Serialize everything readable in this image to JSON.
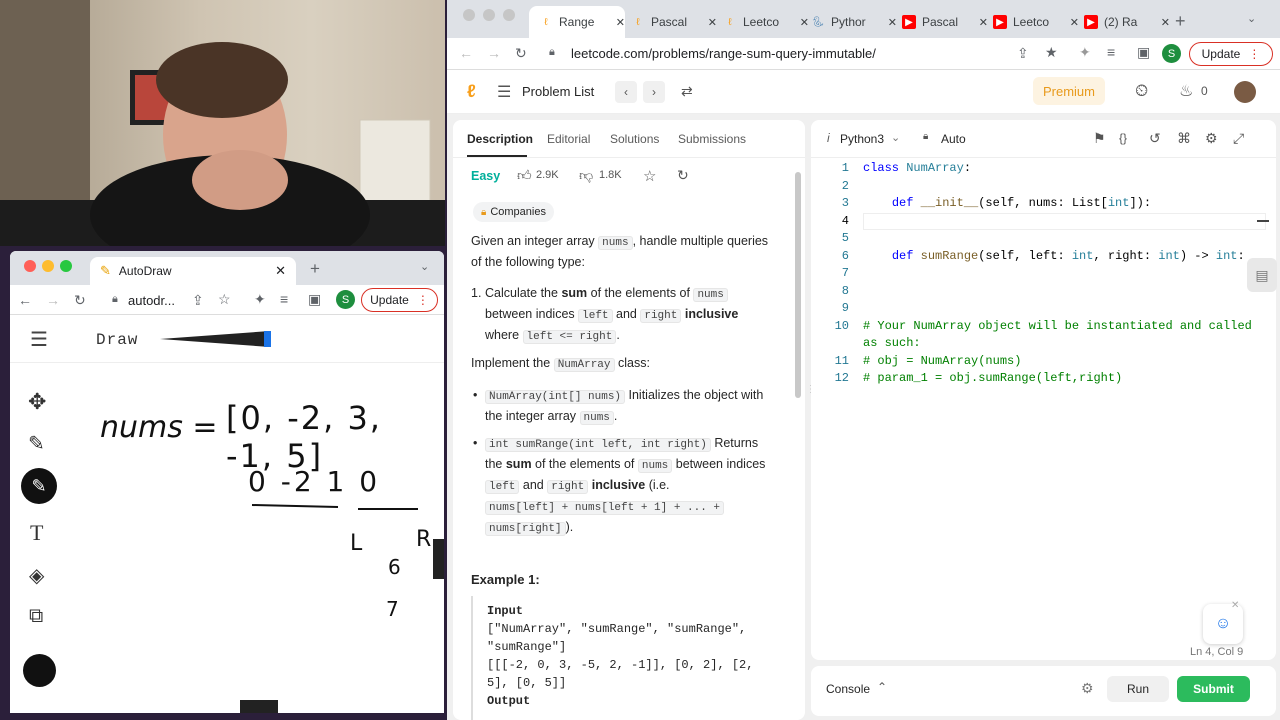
{
  "small_window": {
    "tab_title": "AutoDraw",
    "url": "autodr...",
    "update_label": "Update",
    "profile_initial": "S",
    "app_title": "Draw",
    "drawing_text": {
      "nums": "nums =",
      "array": "[0, -2, 3, -1, 5]",
      "prefix": "0  -2  1  0",
      "L": "L",
      "R": "R",
      "six": "6",
      "seven": "7"
    }
  },
  "big_window": {
    "tabs": [
      {
        "label": "Range",
        "fav": "leetcode-icon",
        "color": "#f89f1b"
      },
      {
        "label": "Pascal",
        "fav": "leetcode-icon",
        "color": "#f89f1b"
      },
      {
        "label": "Leetco",
        "fav": "leetcode-icon",
        "color": "#f89f1b"
      },
      {
        "label": "Pythor",
        "fav": "python-icon",
        "color": "#3776ab"
      },
      {
        "label": "Pascal",
        "fav": "youtube-icon",
        "color": "#ff0000"
      },
      {
        "label": "Leetco",
        "fav": "youtube-icon",
        "color": "#ff0000"
      },
      {
        "label": "(2) Ra",
        "fav": "youtube-icon",
        "color": "#ff0000"
      }
    ],
    "url": "leetcode.com/problems/range-sum-query-immutable/",
    "update_label": "Update",
    "profile_initial": "S",
    "nav": {
      "problem_list": "Problem List",
      "premium": "Premium",
      "streak": "0"
    },
    "left_tabs": [
      "Description",
      "Editorial",
      "Solutions",
      "Submissions"
    ],
    "difficulty": "Easy",
    "likes": "2.9K",
    "dislikes": "1.8K",
    "companies": "Companies",
    "desc": {
      "intro_a": "Given an integer array ",
      "nums": "nums",
      "intro_b": ", handle multiple queries of the following type:",
      "item1_a": "Calculate the ",
      "sum": "sum",
      "item1_b": " of the elements of ",
      "item1_c": "between indices ",
      "left": "left",
      "and": " and ",
      "right": "right",
      "inclusive": "inclusive",
      "where": "where ",
      "cond": "left <= right",
      "period": ".",
      "impl_a": "Implement the ",
      "numarray": "NumArray",
      "impl_b": " class:",
      "b1_code": "NumArray(int[] nums)",
      "b1_text": " Initializes the object with the integer array ",
      "b2_code": "int sumRange(int left, int right)",
      "b2_text": " Returns the ",
      "b2_text2": " of the elements of ",
      "b2_text3": " between indices ",
      "b2_ie": " (i.e.",
      "b2_formula1": "nums[left] + nums[left + 1] + ... +",
      "b2_formula2": "nums[right]",
      "b2_end": ").",
      "example_title": "Example 1:",
      "input_label": "Input",
      "input_line1": "[\"NumArray\", \"sumRange\", \"sumRange\",",
      "input_line2": "\"sumRange\"]",
      "input_line3": "[[[-2, 0, 3, -5, 2, -1]], [0, 2], [2,",
      "input_line4": "5], [0, 5]]",
      "output_label": "Output"
    },
    "editor": {
      "language": "Python3",
      "auto": "Auto",
      "status": "Ln 4, Col 9",
      "console": "Console",
      "run": "Run",
      "submit": "Submit"
    }
  }
}
